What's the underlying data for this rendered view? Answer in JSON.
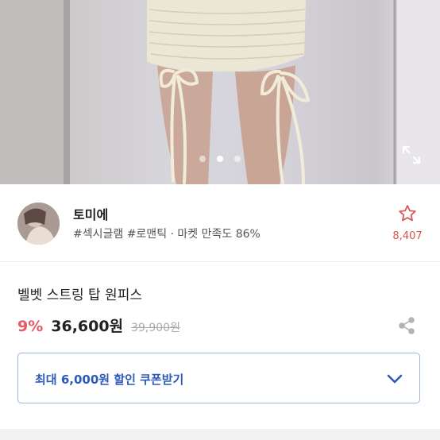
{
  "gallery": {
    "slide_count": 3,
    "active_index": 1,
    "expand_icon": "expand-icon"
  },
  "seller": {
    "name": "토미에",
    "tags": "#섹시글램 #로맨틱 · 마켓 만족도 86%",
    "favorite_icon": "star-outline-icon",
    "favorite_count": "8,407",
    "accent_color": "#d9534f"
  },
  "product": {
    "title": "벨벳 스트링 탑 원피스",
    "discount": "9%",
    "price": "36,600원",
    "original_price": "39,900원",
    "share_icon": "share-icon"
  },
  "coupon": {
    "label": "최대 6,000원 할인 쿠폰받기",
    "chevron_icon": "chevron-down-icon",
    "color": "#2d59b8"
  }
}
